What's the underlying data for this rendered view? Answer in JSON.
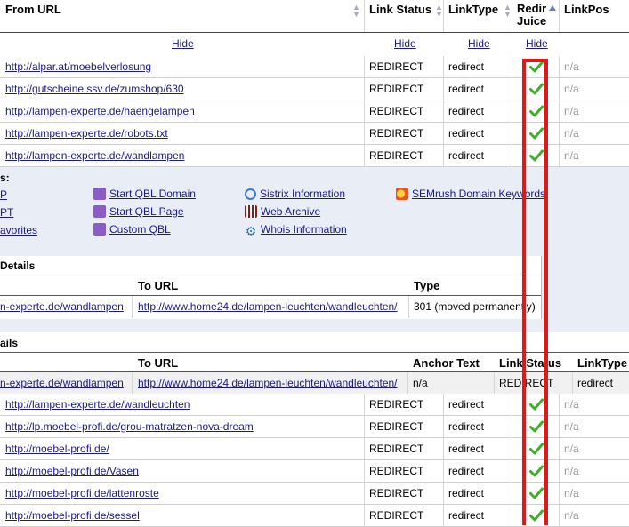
{
  "main_table": {
    "headers": {
      "from_url": "From URL",
      "link_status": "Link Status",
      "link_type": "LinkType",
      "redir_juice_1": "Redir",
      "redir_juice_2": "Juice",
      "link_pos": "LinkPos"
    },
    "hide_label": "Hide",
    "rows": [
      {
        "url": "http://alpar.at/moebelverlosung",
        "status": "REDIRECT",
        "type": "redirect",
        "pos": "n/a"
      },
      {
        "url": "http://gutscheine.ssv.de/zumshop/630",
        "status": "REDIRECT",
        "type": "redirect",
        "pos": "n/a"
      },
      {
        "url": "http://lampen-experte.de/haengelampen",
        "status": "REDIRECT",
        "type": "redirect",
        "pos": "n/a"
      },
      {
        "url": "http://lampen-experte.de/robots.txt",
        "status": "REDIRECT",
        "type": "redirect",
        "pos": "n/a"
      },
      {
        "url": "http://lampen-experte.de/wandlampen",
        "status": "REDIRECT",
        "type": "redirect",
        "pos": "n/a"
      }
    ]
  },
  "tools_panel": {
    "colon": "s:",
    "left_col": [
      "P",
      "PT",
      "avorites"
    ],
    "links": [
      {
        "label": "Start QBL Domain",
        "icon": "qbl-icon"
      },
      {
        "label": "Start QBL Page",
        "icon": "qbl-icon"
      },
      {
        "label": "Custom QBL",
        "icon": "qbl-icon"
      },
      {
        "label": "Sistrix Information",
        "icon": "magnifier-icon"
      },
      {
        "label": "Web Archive",
        "icon": "archive-icon"
      },
      {
        "label": "Whois Information",
        "icon": "gear-icon"
      },
      {
        "label": "SEMrush Domain Keywords",
        "icon": "semrush-icon"
      }
    ]
  },
  "redirect_details": {
    "title": "Details",
    "col_to_url": "To URL",
    "col_type": "Type",
    "from": "n-experte.de/wandlampen",
    "to": "http://www.home24.de/lampen-leuchten/wandleuchten/",
    "type": "301 (moved permanently)"
  },
  "link_details": {
    "title": "ails",
    "col_to_url": "To URL",
    "col_anchor": "Anchor Text",
    "col_status": "Link Status",
    "col_type": "LinkType",
    "from": "n-experte.de/wandlampen",
    "to": "http://www.home24.de/lampen-leuchten/wandleuchten/",
    "anchor": "n/a",
    "status": "REDIRECT",
    "type": "redirect"
  },
  "lower_rows": [
    {
      "url": "http://lampen-experte.de/wandleuchten",
      "status": "REDIRECT",
      "type": "redirect",
      "pos": "n/a"
    },
    {
      "url": "http://lp.moebel-profi.de/grou-matratzen-nova-dream",
      "status": "REDIRECT",
      "type": "redirect",
      "pos": "n/a"
    },
    {
      "url": "http://moebel-profi.de/",
      "status": "REDIRECT",
      "type": "redirect",
      "pos": "n/a"
    },
    {
      "url": "http://moebel-profi.de/Vasen",
      "status": "REDIRECT",
      "type": "redirect",
      "pos": "n/a"
    },
    {
      "url": "http://moebel-profi.de/lattenroste",
      "status": "REDIRECT",
      "type": "redirect",
      "pos": "n/a"
    },
    {
      "url": "http://moebel-profi.de/sessel",
      "status": "REDIRECT",
      "type": "redirect",
      "pos": "n/a"
    }
  ],
  "colors": {
    "link": "#1a1a8c",
    "check": "#3fae2a",
    "highlight": "#e01818",
    "panel": "#e9edf5"
  }
}
